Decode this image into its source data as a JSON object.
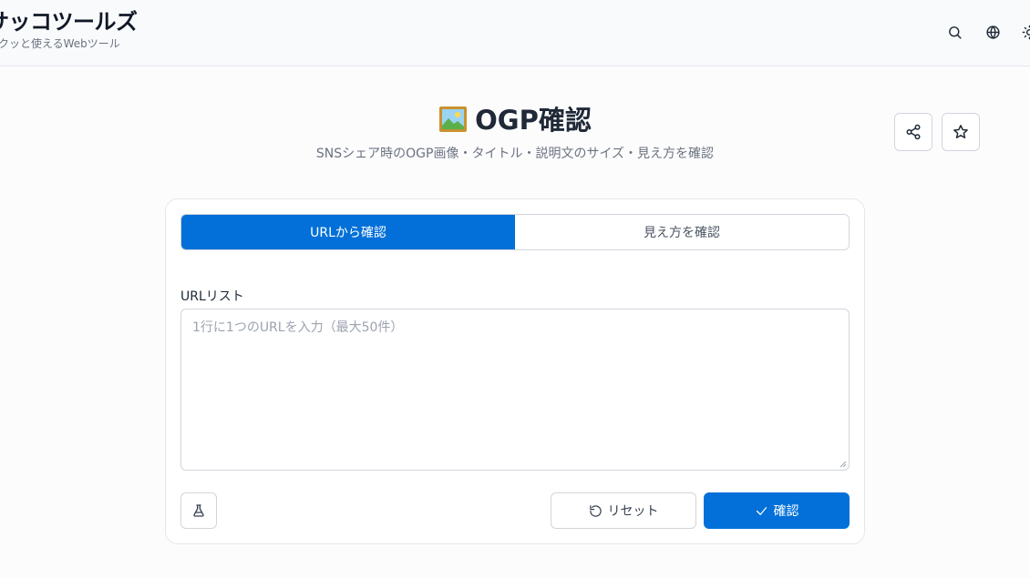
{
  "header": {
    "brand_title": "サッコツールズ",
    "brand_subtitle": "サクッと使えるWebツール",
    "icons": [
      "search-icon",
      "globe-icon",
      "sun-icon"
    ]
  },
  "page": {
    "emoji": "🖼️",
    "title": "OGP確認",
    "subtitle": "SNSシェア時のOGP画像・タイトル・説明文のサイズ・見え方を確認",
    "actions": [
      "share-icon",
      "star-icon"
    ]
  },
  "tabs": [
    {
      "label": "URLから確認",
      "active": true
    },
    {
      "label": "見え方を確認",
      "active": false
    }
  ],
  "form": {
    "url_label": "URLリスト",
    "placeholder": "1行に1つのURLを入力（最大50件）",
    "value": ""
  },
  "buttons": {
    "sample_icon": "flask-icon",
    "reset": "リセット",
    "confirm": "確認"
  },
  "colors": {
    "accent": "#0270d8",
    "border": "#d1d5db",
    "muted_text": "#6b7280"
  }
}
